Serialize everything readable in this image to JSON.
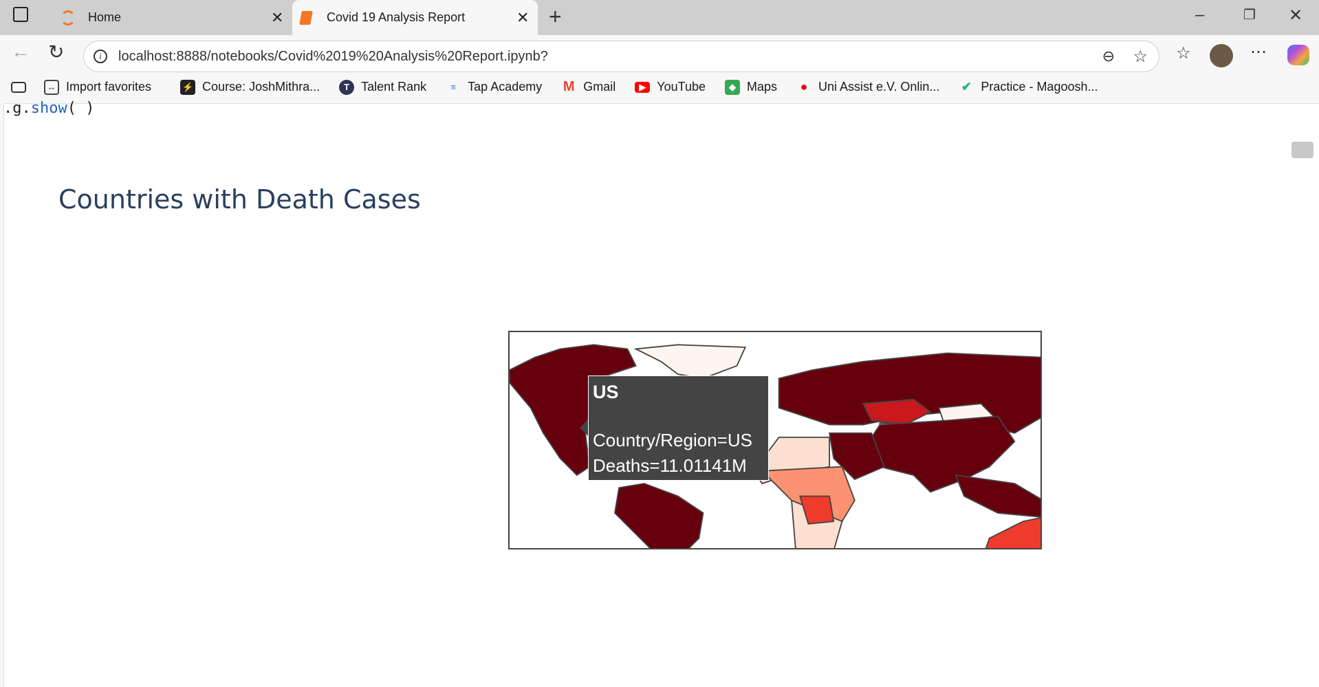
{
  "browser": {
    "tabs": [
      {
        "label": "Home",
        "active": false
      },
      {
        "label": "Covid 19 Analysis Report",
        "active": true
      }
    ],
    "url": "localhost:8888/notebooks/Covid%2019%20Analysis%20Report.ipynb?",
    "bookmarks": [
      {
        "label": "Import favorites",
        "icon": "import-icon"
      },
      {
        "label": "Course: JoshMithra...",
        "icon": "bolt-icon",
        "color": "#222222"
      },
      {
        "label": "Talent Rank",
        "icon": "t-logo-icon",
        "color": "#2e3453"
      },
      {
        "label": "Tap Academy",
        "icon": "tap-academy-icon",
        "color": "#1e88e5"
      },
      {
        "label": "Gmail",
        "icon": "gmail-icon",
        "color": "#ea4335"
      },
      {
        "label": "YouTube",
        "icon": "youtube-icon",
        "color": "#ff0000"
      },
      {
        "label": "Maps",
        "icon": "maps-icon",
        "color": "#34a853"
      },
      {
        "label": "Uni Assist e.V. Onlin...",
        "icon": "uni-assist-icon",
        "color": "#e30613"
      },
      {
        "label": "Practice - Magoosh...",
        "icon": "magoosh-icon",
        "color": "#22b573"
      }
    ]
  },
  "notebook": {
    "code_prefix": ".g.",
    "code_method": "show",
    "code_suffix": "( )"
  },
  "chart_data": {
    "type": "choropleth",
    "title": "Countries with Death Cases",
    "colorscale": "Reds",
    "hover": {
      "name": "US",
      "lines": [
        "Country/Region=US",
        "Deaths=11.01141M"
      ]
    },
    "colors": {
      "high": "#67000d",
      "upper": "#cb181d",
      "mid": "#ef3b2c",
      "lower": "#fc9272",
      "low": "#fee0d2",
      "lowest": "#fff5f0",
      "none": "#e6ecf5"
    }
  }
}
